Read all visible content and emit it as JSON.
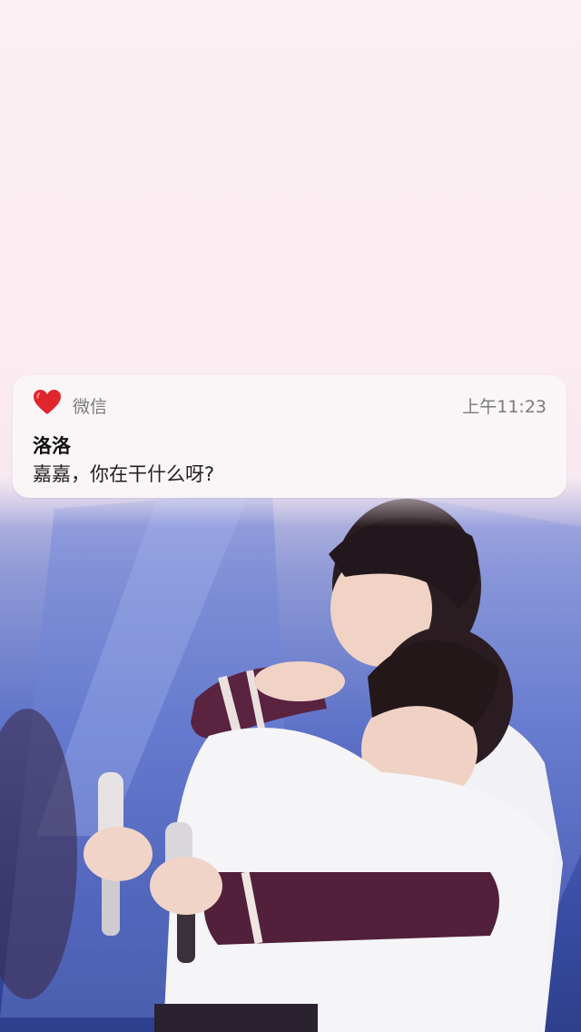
{
  "notification": {
    "app_icon": "red-heart-icon",
    "app_name": "微信",
    "time": "上午11:23",
    "sender": "洛洛",
    "message": "嘉嘉，你在干什么呀?"
  },
  "wallpaper": {
    "description_icon": "photo-wallpaper",
    "colors": {
      "top_background": "#fbeef2",
      "stage_blue": "#4a5fbe",
      "jacket_maroon": "#5a2340",
      "shirt_white": "#f4f4f6",
      "heart_red": "#e0262c"
    }
  }
}
